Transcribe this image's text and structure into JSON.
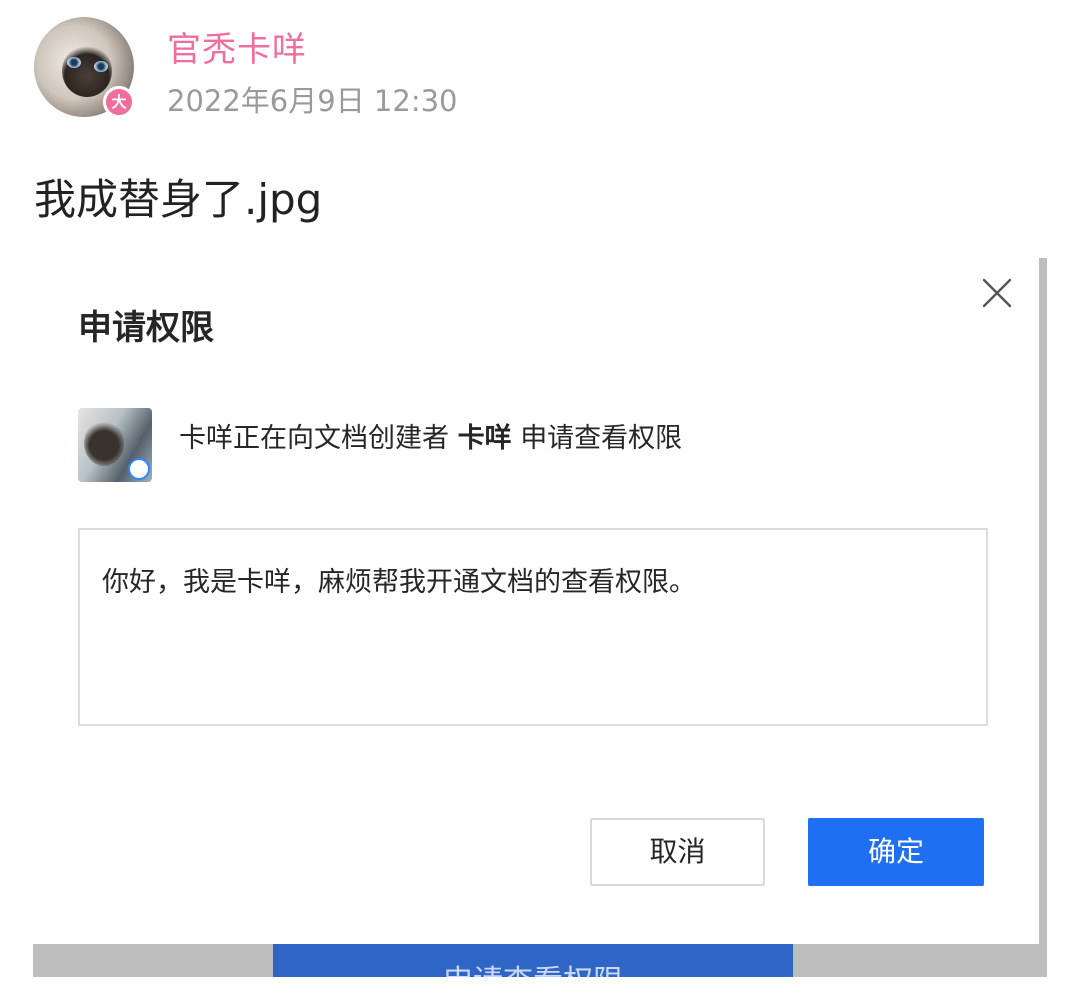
{
  "post": {
    "username": "官秃卡咩",
    "badge": "大",
    "timestamp": "2022年6月9日 12:30",
    "text": "我成替身了.jpg"
  },
  "dialog": {
    "title": "申请权限",
    "request_prefix": "卡咩正在向文档创建者",
    "request_owner": "卡咩",
    "request_suffix": "申请查看权限",
    "message": "你好，我是卡咩，麻烦帮我开通文档的查看权限。",
    "cancel_label": "取消",
    "confirm_label": "确定",
    "background_button_label": "申请查看权限"
  },
  "colors": {
    "username": "#f06e9c",
    "primary": "#1f6ff2",
    "badge": "#f06e9c"
  },
  "icons": {
    "close": "close-icon"
  }
}
